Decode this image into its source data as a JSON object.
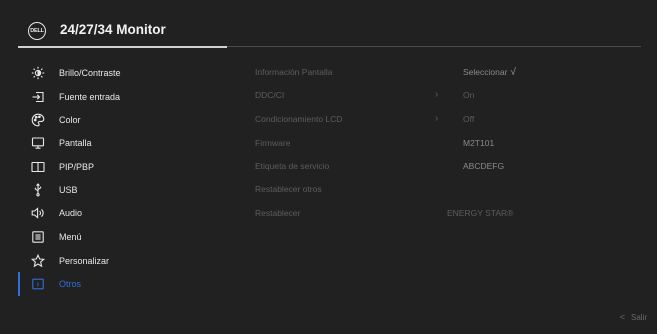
{
  "header": {
    "brand": "DELL",
    "title": "24/27/34 Monitor"
  },
  "sidebar": {
    "items": [
      {
        "label": "Brillo/Contraste",
        "icon": "brightness-icon"
      },
      {
        "label": "Fuente entrada",
        "icon": "input-source-icon"
      },
      {
        "label": "Color",
        "icon": "color-palette-icon"
      },
      {
        "label": "Pantalla",
        "icon": "display-icon"
      },
      {
        "label": "PIP/PBP",
        "icon": "pip-pbp-icon"
      },
      {
        "label": "USB",
        "icon": "usb-icon"
      },
      {
        "label": "Audio",
        "icon": "speaker-icon"
      },
      {
        "label": "Menú",
        "icon": "menu-icon"
      },
      {
        "label": "Personalizar",
        "icon": "star-icon"
      },
      {
        "label": "Otros",
        "icon": "others-icon"
      }
    ],
    "active_index": 9
  },
  "content": {
    "rows": [
      {
        "name": "Información Pantalla",
        "arrow": "",
        "value": "Seleccionar",
        "check": "√"
      },
      {
        "name": "DDC/CI",
        "arrow": "›",
        "value": "On",
        "check": ""
      },
      {
        "name": "Condicionamiento LCD",
        "arrow": "›",
        "value": "Off",
        "check": ""
      },
      {
        "name": "Firmware",
        "arrow": "",
        "value": "M2T101",
        "check": ""
      },
      {
        "name": "Etiqueta de servicio",
        "arrow": "",
        "value": "ABCDEFG",
        "check": ""
      },
      {
        "name": "Restablecer otros",
        "arrow": "",
        "value": "",
        "check": ""
      },
      {
        "name": "Restablecer",
        "arrow": "",
        "value": "ENERGY STAR®",
        "check": ""
      }
    ]
  },
  "footer": {
    "exit_label": "Salir"
  },
  "colors": {
    "background": "#212121",
    "accent": "#2f6fd8",
    "text": "#e8e8e8",
    "disabled_text": "#5d5d5d"
  }
}
